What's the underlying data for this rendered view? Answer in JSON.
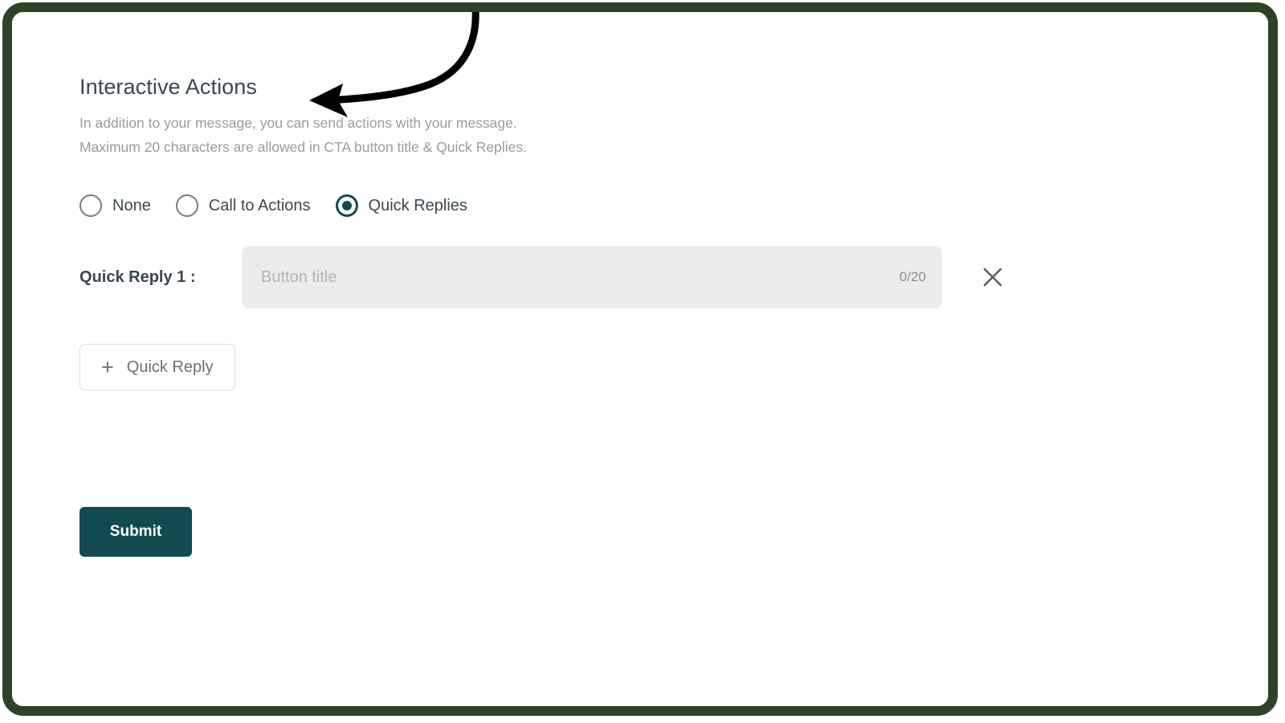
{
  "frame": {
    "border_color": "#2f4225",
    "background": "#ffffff"
  },
  "section": {
    "title": "Interactive Actions",
    "description_line_1": "In addition to your message, you can send actions with your message.",
    "description_line_2": "Maximum 20 characters are allowed in CTA button title & Quick Replies."
  },
  "action_type": {
    "selected": "Quick Replies",
    "options": [
      {
        "label": "None",
        "selected": false
      },
      {
        "label": "Call to Actions",
        "selected": false
      },
      {
        "label": "Quick Replies",
        "selected": true
      }
    ]
  },
  "quick_replies": [
    {
      "label": "Quick Reply 1 :",
      "value": "",
      "placeholder": "Button title",
      "counter": "0/20",
      "remove_icon": "close-icon"
    }
  ],
  "add_button": {
    "icon": "plus-icon",
    "icon_glyph": "+",
    "label": "Quick Reply"
  },
  "submit": {
    "label": "Submit",
    "color": "#124b4f"
  },
  "annotation": {
    "type": "curved-arrow",
    "color": "#000000",
    "points_to": "Interactive Actions"
  },
  "colors": {
    "accent": "#124b4f",
    "frame": "#2f4225",
    "input_background": "#ececec",
    "muted_text": "#9b9b9b",
    "heading_text": "#3a4750"
  }
}
